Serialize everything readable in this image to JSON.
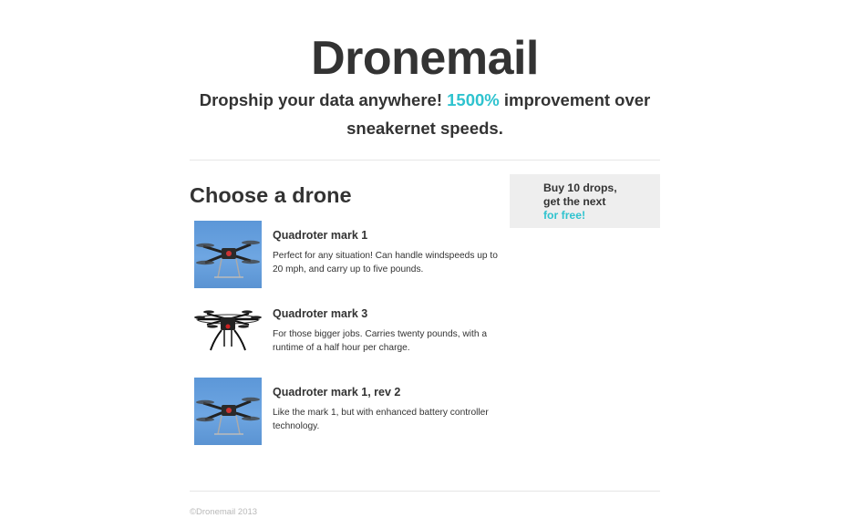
{
  "header": {
    "brand": "Dronemail",
    "tagline_before": "Dropship your data anywhere! ",
    "tagline_accent": "1500%",
    "tagline_after": " improvement over sneakernet speeds."
  },
  "main": {
    "section_title": "Choose a drone",
    "drones": [
      {
        "name": "Quadroter mark 1",
        "description": "Perfect for any situation! Can handle windspeeds up to 20 mph, and carry up to five pounds.",
        "image": "quadcopter-sky-photo"
      },
      {
        "name": "Quadroter mark 3",
        "description": "For those bigger jobs. Carries twenty pounds, with a runtime of a half hour per charge.",
        "image": "octocopter-white-photo"
      },
      {
        "name": "Quadroter mark 1, rev 2",
        "description": "Like the mark 1, but with enhanced battery controller technology.",
        "image": "quadcopter-sky-photo"
      }
    ]
  },
  "promo": {
    "line1": "Buy 10 drops,",
    "line2": "get the next",
    "line3": "for free!"
  },
  "footer": {
    "copyright": "©Dronemail 2013"
  },
  "colors": {
    "accent": "#2fc3cf",
    "text": "#333333",
    "promo_bg": "#eeeeee",
    "footer_text": "#b8b8b8"
  }
}
